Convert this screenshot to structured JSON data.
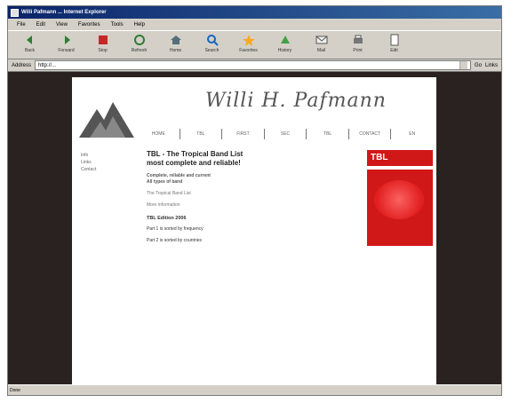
{
  "window": {
    "title": "Willi Pafmann ... Internet Explorer"
  },
  "menu": [
    "File",
    "Edit",
    "View",
    "Favorites",
    "Tools",
    "Help"
  ],
  "toolbar": [
    {
      "label": "Back",
      "icon": "back-icon"
    },
    {
      "label": "Forward",
      "icon": "forward-icon"
    },
    {
      "label": "Stop",
      "icon": "stop-icon"
    },
    {
      "label": "Refresh",
      "icon": "refresh-icon"
    },
    {
      "label": "Home",
      "icon": "home-icon"
    },
    {
      "label": "Search",
      "icon": "search-icon"
    },
    {
      "label": "Favorites",
      "icon": "favorites-icon"
    },
    {
      "label": "History",
      "icon": "history-icon"
    },
    {
      "label": "Mail",
      "icon": "mail-icon"
    },
    {
      "label": "Print",
      "icon": "print-icon"
    },
    {
      "label": "Edit",
      "icon": "edit-icon"
    }
  ],
  "address": {
    "label": "Address",
    "value": "http://...",
    "go": "Go",
    "links": "Links"
  },
  "site": {
    "title": "Willi H. Pafmann",
    "nav": [
      "HOME",
      "TBL",
      "FIRST",
      "SEC",
      "TBL",
      "CONTACT",
      "EN"
    ],
    "side": [
      "Info",
      "Links",
      "Contact"
    ],
    "heading": "TBL - The Tropical Band List",
    "subheading": "most complete and reliable!",
    "bullets": [
      "Complete, reliable and current",
      "All types of band"
    ],
    "para1": "The Tropical Band List",
    "para2": "More information",
    "section": "TBL Edition 2006",
    "part1": "Part 1 is sorted by frequency",
    "part2": "Part 2 is sorted by countries",
    "book_title": "TBL"
  },
  "status": "Done"
}
